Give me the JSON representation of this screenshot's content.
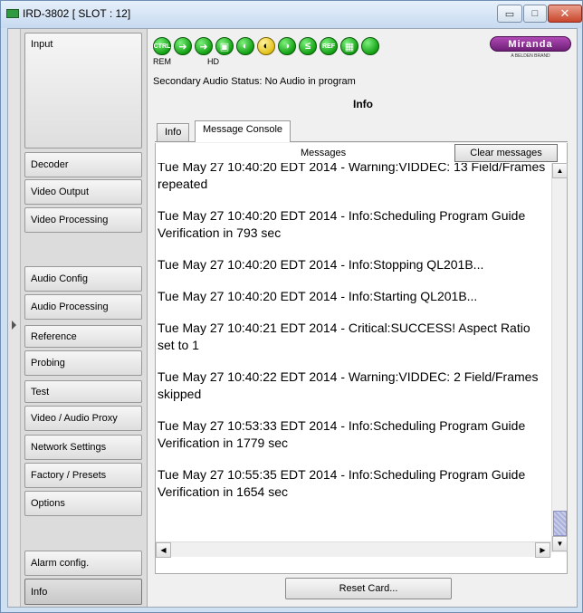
{
  "window": {
    "title": "IRD-3802 [ SLOT : 12]",
    "controls": {
      "minimize": "▭",
      "maximize": "□",
      "close": "✕"
    }
  },
  "sidebar": {
    "items": [
      {
        "label": "Input",
        "active": false
      },
      {
        "label": "Decoder",
        "active": false
      },
      {
        "label": "Video Output",
        "active": false
      },
      {
        "label": "Video Processing",
        "active": false
      },
      {
        "label": "Audio Config",
        "active": false
      },
      {
        "label": "Audio Processing",
        "active": false
      },
      {
        "label": "Reference",
        "active": false
      },
      {
        "label": "Probing",
        "active": false
      },
      {
        "label": "Test",
        "active": false
      },
      {
        "label": "Video / Audio Proxy",
        "active": false
      },
      {
        "label": "Network Settings",
        "active": false
      },
      {
        "label": "Factory / Presets",
        "active": false
      },
      {
        "label": "Options",
        "active": false
      },
      {
        "label": "Alarm config.",
        "active": false
      },
      {
        "label": "Info",
        "active": true
      }
    ]
  },
  "toolbar": {
    "icons": [
      {
        "name": "ctrl-icon",
        "text": "CTRL",
        "color": "green"
      },
      {
        "name": "arrow-right-icon",
        "text": "➜",
        "color": "green"
      },
      {
        "name": "arrow-right-hd-icon",
        "text": "➜",
        "color": "green"
      },
      {
        "name": "processing-icon",
        "text": "▣",
        "color": "green"
      },
      {
        "name": "audio-icon",
        "text": "◐",
        "color": "green"
      },
      {
        "name": "audio-warning-icon",
        "text": "◐",
        "color": "yellow"
      },
      {
        "name": "audio-processing-icon",
        "text": "◑",
        "color": "green"
      },
      {
        "name": "level-icon",
        "text": "≤",
        "color": "green"
      },
      {
        "name": "reference-icon",
        "text": "REF",
        "color": "green"
      },
      {
        "name": "video-icon",
        "text": "▦",
        "color": "green"
      },
      {
        "name": "status-led-icon",
        "text": "",
        "color": "green"
      }
    ],
    "rem_label": "REM",
    "hd_label": "HD"
  },
  "brand": {
    "name": "Miranda",
    "sub": "A BELDEN BRAND"
  },
  "status_line": "Secondary Audio Status: No Audio in program",
  "panel_title": "Info",
  "tabs": [
    {
      "label": "Info",
      "active": false
    },
    {
      "label": "Message Console",
      "active": true
    }
  ],
  "console": {
    "header": "Messages",
    "clear_label": "Clear messages",
    "messages": [
      "Tue May 27 10:40:20 EDT 2014 - Warning:VIDDEC: 13 Field/Frames repeated",
      "Tue May 27 10:40:20 EDT 2014 - Info:Scheduling Program Guide Verification in 793 sec",
      "Tue May 27 10:40:20 EDT 2014 - Info:Stopping QL201B...",
      "Tue May 27 10:40:20 EDT 2014 - Info:Starting QL201B...",
      "Tue May 27 10:40:21 EDT 2014 - Critical:SUCCESS!  Aspect Ratio set to 1",
      "Tue May 27 10:40:22 EDT 2014 - Warning:VIDDEC: 2 Field/Frames skipped",
      "Tue May 27 10:53:33 EDT 2014 - Info:Scheduling Program Guide Verification in 1779 sec",
      "Tue May 27 10:55:35 EDT 2014 - Info:Scheduling Program Guide Verification in 1654 sec"
    ],
    "scroll_up": "▲",
    "scroll_down": "▼",
    "scroll_left": "◀",
    "scroll_right": "▶"
  },
  "reset_label": "Reset Card...",
  "colors": {
    "accent_green": "#14a114",
    "warning_yellow": "#e3c21a",
    "brand_purple": "#8a2e90"
  }
}
